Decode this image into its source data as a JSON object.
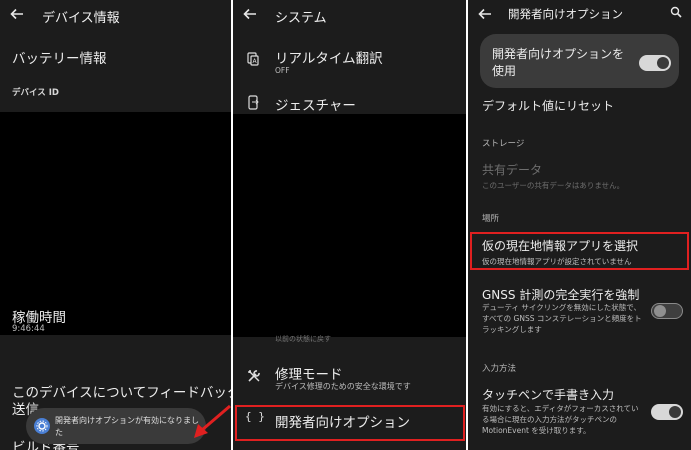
{
  "panel1": {
    "title": "デバイス情報",
    "battery": "バッテリー情報",
    "device_id_label": "デバイス ID",
    "uptime_label": "稼働時間",
    "uptime_value": "9:46:44",
    "feedback_line1": "このデバイスについてフィードバックを",
    "feedback_line2": "送信",
    "build_partial": "ビルド番号",
    "toast_line1": "開発者向けオプションが有効になりまし",
    "toast_line2": "た"
  },
  "panel2": {
    "title": "システム",
    "live_translate": "リアルタイム翻訳",
    "live_translate_sub": "OFF",
    "gestures": "ジェスチャー",
    "partial_text": "以前の状態に戻す",
    "repair_mode": "修理モード",
    "repair_mode_sub": "デバイス修理のための安全な環境です",
    "developer_options": "開発者向けオプション"
  },
  "panel3": {
    "title": "開発者向けオプション",
    "use_dev_line1": "開発者向けオプションを",
    "use_dev_line2": "使用",
    "reset_defaults": "デフォルト値にリセット",
    "storage_header": "ストレージ",
    "shared_data": "共有データ",
    "shared_data_sub": "このユーザーの共有データはありません。",
    "location_header": "場所",
    "mock_location": "仮の現在地情報アプリを選択",
    "mock_location_sub": "仮の現在地情報アプリが設定されていません",
    "gnss_title": "GNSS 計測の完全実行を強制",
    "gnss_sub": "デューティ サイクリングを無効にした状態で、すべての GNSS コンステレーションと頻度をトラッキングします",
    "input_header": "入力方法",
    "stylus_title": "タッチペンで手書き入力",
    "stylus_sub": "有効にすると、エディタがフォーカスされている場合に現在の入力方法がタッチペンの MotionEvent を受け取ります。"
  },
  "toggles": {
    "use_dev_options": true,
    "gnss_full_tracking": false,
    "stylus_handwriting": true
  },
  "colors": {
    "background": "#1c1c1c",
    "highlight": "#e02020",
    "toast_icon": "#4a7fd4"
  },
  "icons": [
    "back-arrow-icon",
    "translate-icon",
    "gesture-phone-icon",
    "repair-tools-icon",
    "code-braces-icon",
    "search-icon",
    "settings-gear-icon"
  ]
}
